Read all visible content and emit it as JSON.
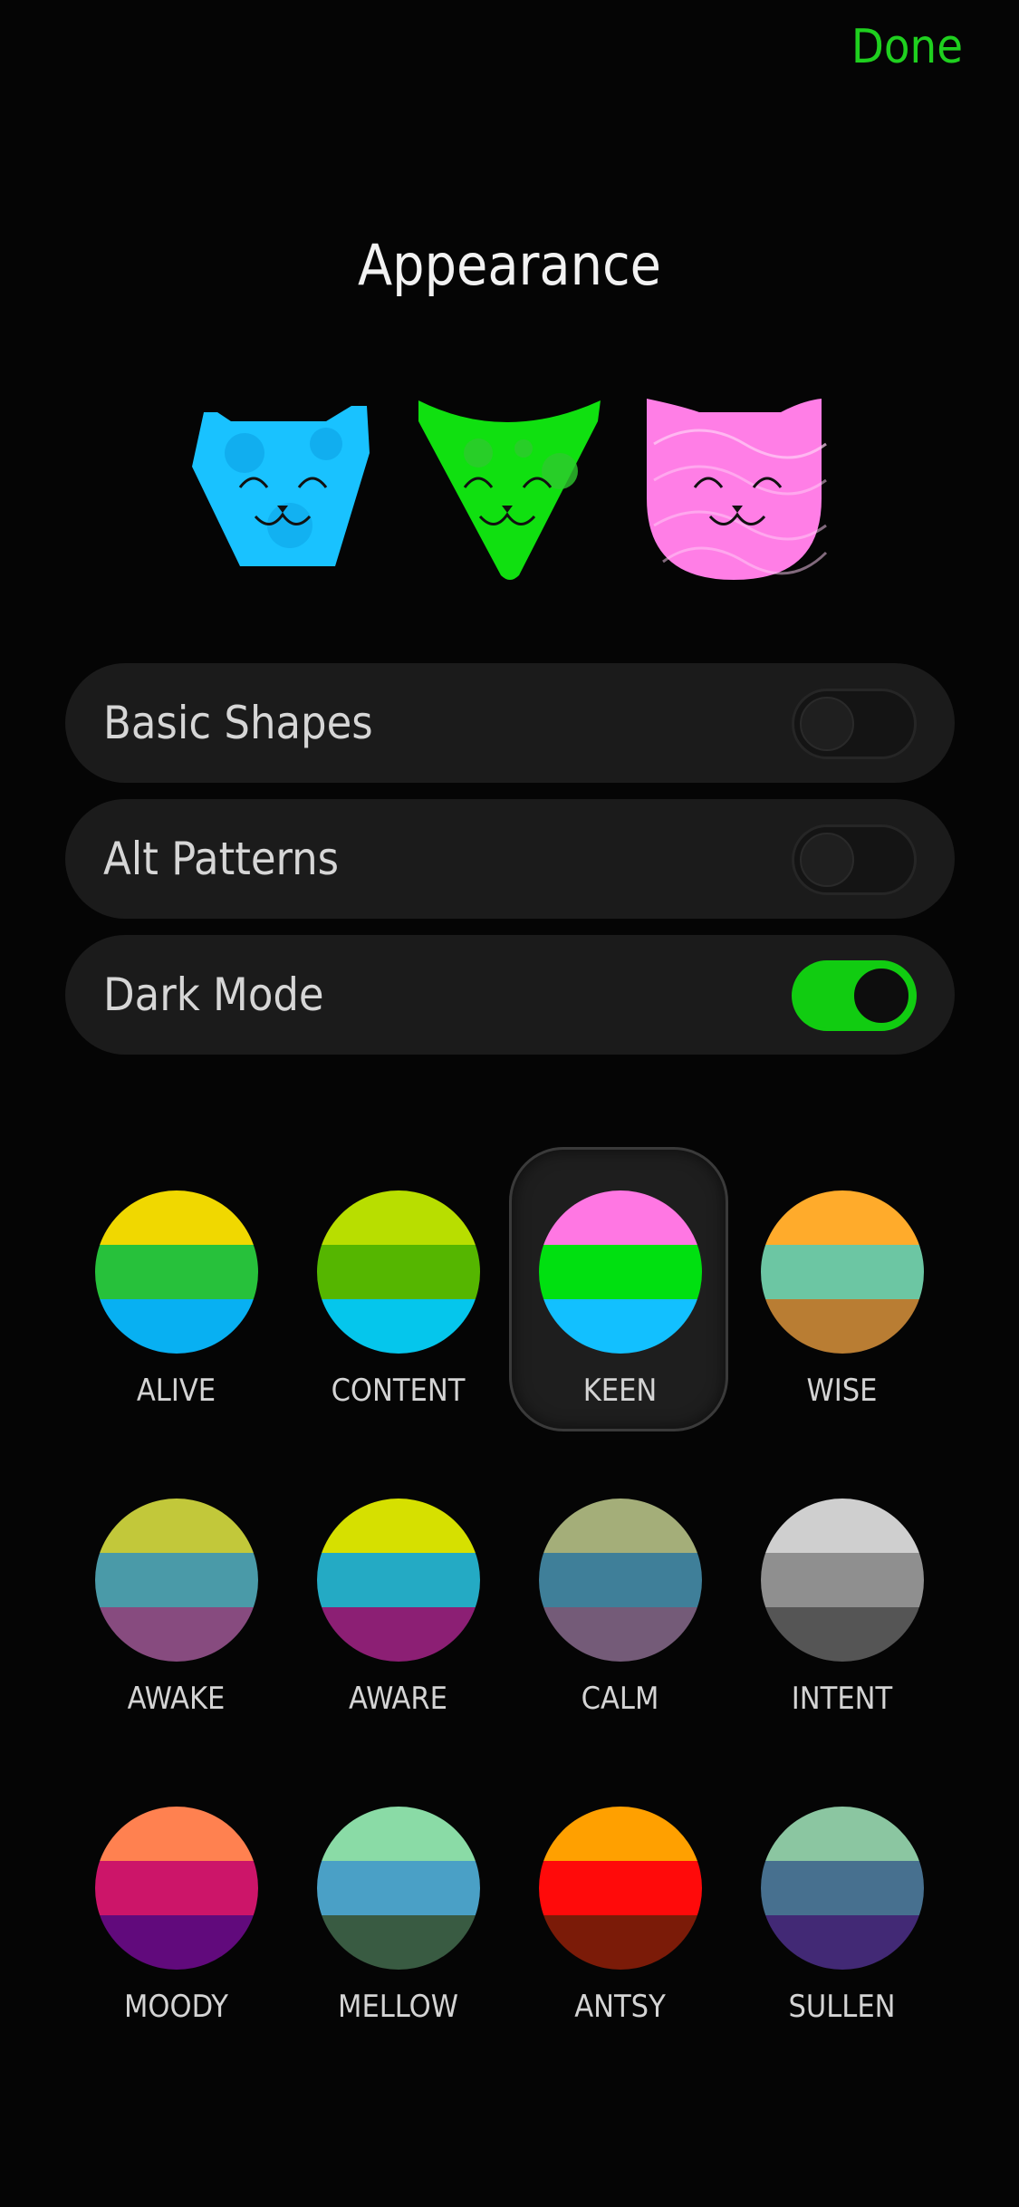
{
  "header": {
    "done_label": "Done",
    "title": "Appearance"
  },
  "cats": [
    {
      "name": "blue-cat",
      "color": "#19c2ff"
    },
    {
      "name": "green-cat",
      "color": "#10e010"
    },
    {
      "name": "pink-cat",
      "color": "#ff7ee6"
    }
  ],
  "settings": [
    {
      "label": "Basic Shapes",
      "on": false
    },
    {
      "label": "Alt Patterns",
      "on": false
    },
    {
      "label": "Dark Mode",
      "on": true
    }
  ],
  "palettes": [
    {
      "label": "ALIVE",
      "colors": [
        "#f0d800",
        "#27c13b",
        "#08b0f2"
      ],
      "selected": false
    },
    {
      "label": "CONTENT",
      "colors": [
        "#b8de00",
        "#55b600",
        "#05c6ec"
      ],
      "selected": false
    },
    {
      "label": "KEEN",
      "colors": [
        "#ff77e3",
        "#00e010",
        "#12c0ff"
      ],
      "selected": true
    },
    {
      "label": "WISE",
      "colors": [
        "#ffab2b",
        "#6cc6a3",
        "#b97d33"
      ],
      "selected": false
    },
    {
      "label": "AWAKE",
      "colors": [
        "#c2c83a",
        "#4a9aa8",
        "#874b7f"
      ],
      "selected": false
    },
    {
      "label": "AWARE",
      "colors": [
        "#d6e000",
        "#24aac4",
        "#8c1f74"
      ],
      "selected": false
    },
    {
      "label": "CALM",
      "colors": [
        "#a4ae79",
        "#3f7f99",
        "#745b78"
      ],
      "selected": false
    },
    {
      "label": "INTENT",
      "colors": [
        "#cfcfcf",
        "#8f8f8f",
        "#555555"
      ],
      "selected": false
    },
    {
      "label": "MOODY",
      "colors": [
        "#ff8150",
        "#cc1569",
        "#610a7c"
      ],
      "selected": false
    },
    {
      "label": "MELLOW",
      "colors": [
        "#8adba6",
        "#4aa0c6",
        "#395b42"
      ],
      "selected": false
    },
    {
      "label": "ANTSY",
      "colors": [
        "#ffa000",
        "#ff0a0a",
        "#7b1b08"
      ],
      "selected": false
    },
    {
      "label": "SULLEN",
      "colors": [
        "#8bc6a1",
        "#47708f",
        "#422975"
      ],
      "selected": false
    }
  ]
}
